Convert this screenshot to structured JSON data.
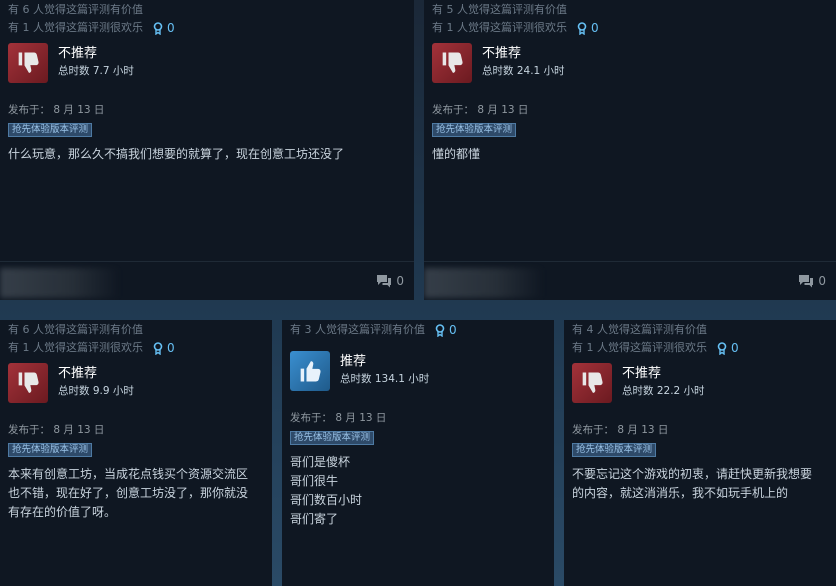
{
  "reviews": [
    {
      "helpful": "有 6 人觉得这篇评测有价值",
      "funny": "有 1 人觉得这篇评测很欢乐",
      "award_count": "0",
      "verdict": "不推荐",
      "recommended": false,
      "hours": "总时数 7.7 小时",
      "posted": "发布于： 8 月 13 日",
      "badge": "抢先体验版本评测",
      "lines": [
        "什么玩意，那么久不搞我们想要的就算了，现在创意工坊还没了"
      ],
      "comment_count": "0"
    },
    {
      "helpful": "有 5 人觉得这篇评测有价值",
      "funny": "有 1 人觉得这篇评测很欢乐",
      "award_count": "0",
      "verdict": "不推荐",
      "recommended": false,
      "hours": "总时数 24.1 小时",
      "posted": "发布于： 8 月 13 日",
      "badge": "抢先体验版本评测",
      "lines": [
        "懂的都懂"
      ],
      "comment_count": "0"
    },
    {
      "helpful": "有 6 人觉得这篇评测有价值",
      "funny": "有 1 人觉得这篇评测很欢乐",
      "award_count": "0",
      "verdict": "不推荐",
      "recommended": false,
      "hours": "总时数 9.9 小时",
      "posted": "发布于： 8 月 13 日",
      "badge": "抢先体验版本评测",
      "lines": [
        "本来有创意工坊，当成花点钱买个资源交流区",
        "也不错，现在好了，创意工坊没了，那你就没",
        "有存在的价值了呀。"
      ]
    },
    {
      "helpful": "有 3 人觉得这篇评测有价值",
      "award_count": "0",
      "verdict": "推荐",
      "recommended": true,
      "hours": "总时数 134.1 小时",
      "posted": "发布于： 8 月 13 日",
      "badge": "抢先体验版本评测",
      "lines": [
        "哥们是傻杯",
        "哥们很牛",
        "哥们数百小时",
        "哥们寄了"
      ]
    },
    {
      "helpful": "有 4 人觉得这篇评测有价值",
      "funny": "有 1 人觉得这篇评测很欢乐",
      "award_count": "0",
      "verdict": "不推荐",
      "recommended": false,
      "hours": "总时数 22.2 小时",
      "posted": "发布于： 8 月 13 日",
      "badge": "抢先体验版本评测",
      "lines": [
        "不要忘记这个游戏的初衷，请赶快更新我想要",
        "的内容，就这消消乐，我不如玩手机上的"
      ]
    }
  ],
  "icons": {
    "thumb_down": "thumbs-down-icon",
    "thumb_up": "thumbs-up-icon",
    "award": "award-icon",
    "comment": "comment-icon"
  },
  "colors": {
    "card_bg": "#0f1722",
    "accent": "#66c0f4",
    "negative": "#a3323a",
    "positive": "#3a8fd0"
  }
}
